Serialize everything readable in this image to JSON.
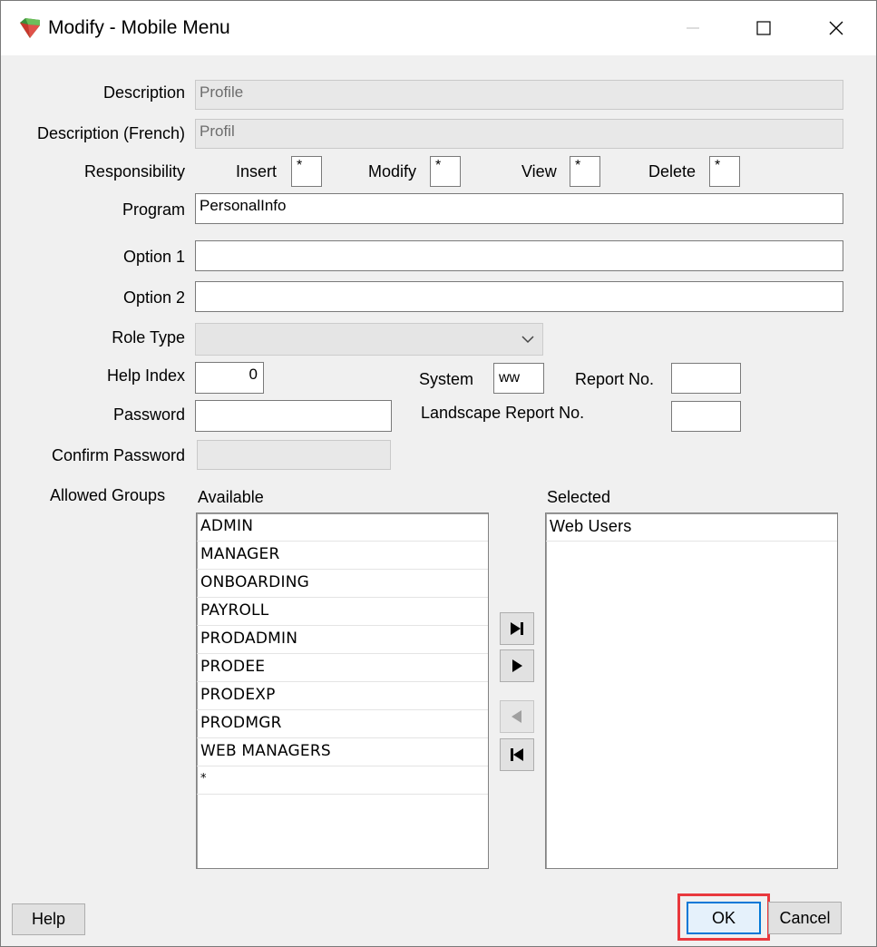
{
  "window": {
    "title": "Modify - Mobile Menu",
    "icon": "gem-app-icon"
  },
  "form": {
    "description": {
      "label": "Description",
      "value": "Profile"
    },
    "description_french": {
      "label": "Description (French)",
      "value": "Profil"
    },
    "responsibility": {
      "label": "Responsibility",
      "insert": {
        "label": "Insert",
        "value": "*"
      },
      "modify": {
        "label": "Modify",
        "value": "*"
      },
      "view": {
        "label": "View",
        "value": "*"
      },
      "delete": {
        "label": "Delete",
        "value": "*"
      }
    },
    "program": {
      "label": "Program",
      "value": "PersonalInfo"
    },
    "option1": {
      "label": "Option 1",
      "value": ""
    },
    "option2": {
      "label": "Option 2",
      "value": ""
    },
    "role_type": {
      "label": "Role Type",
      "value": ""
    },
    "help_index": {
      "label": "Help Index",
      "value": "0"
    },
    "system": {
      "label": "System",
      "value": "ww"
    },
    "report_no": {
      "label": "Report No.",
      "value": ""
    },
    "password": {
      "label": "Password",
      "value": ""
    },
    "landscape_report_no": {
      "label": "Landscape Report No.",
      "value": ""
    },
    "confirm_password": {
      "label": "Confirm Password",
      "value": ""
    }
  },
  "groups": {
    "label": "Allowed Groups",
    "available_label": "Available",
    "selected_label": "Selected",
    "available": [
      "ADMIN",
      "MANAGER",
      "ONBOARDING",
      "PAYROLL",
      "PRODADMIN",
      "PRODEE",
      "PRODEXP",
      "PRODMGR",
      "WEB MANAGERS",
      "*"
    ],
    "selected": [
      "Web Users"
    ]
  },
  "buttons": {
    "help": "Help",
    "ok": "OK",
    "cancel": "Cancel"
  },
  "colors": {
    "highlight": "#e8383d",
    "default_button_border": "#0078d7"
  }
}
